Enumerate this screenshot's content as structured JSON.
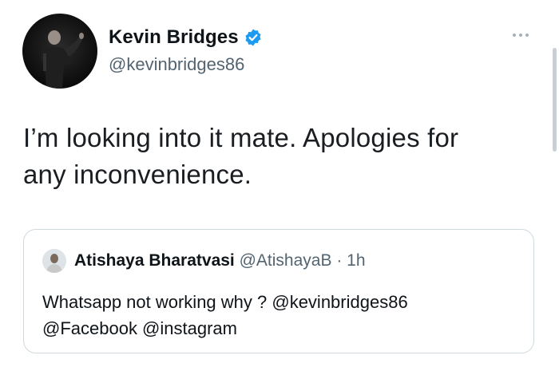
{
  "author": {
    "display_name": "Kevin Bridges",
    "handle": "@kevinbridges86",
    "verified": true
  },
  "tweet": {
    "text_line1": "I’m looking into it mate. Apologies for",
    "text_line2": "any inconvenience."
  },
  "quoted_tweet": {
    "display_name": "Atishaya Bharatvasi",
    "handle": "@AtishayaB",
    "separator": "·",
    "time": "1h",
    "text_line1": "Whatsapp not working why ? @kevinbridges86",
    "text_line2": "@Facebook @instagram"
  },
  "colors": {
    "verified_badge": "#1d9bf0",
    "secondary_text": "#536471",
    "border": "#cfd9de"
  }
}
